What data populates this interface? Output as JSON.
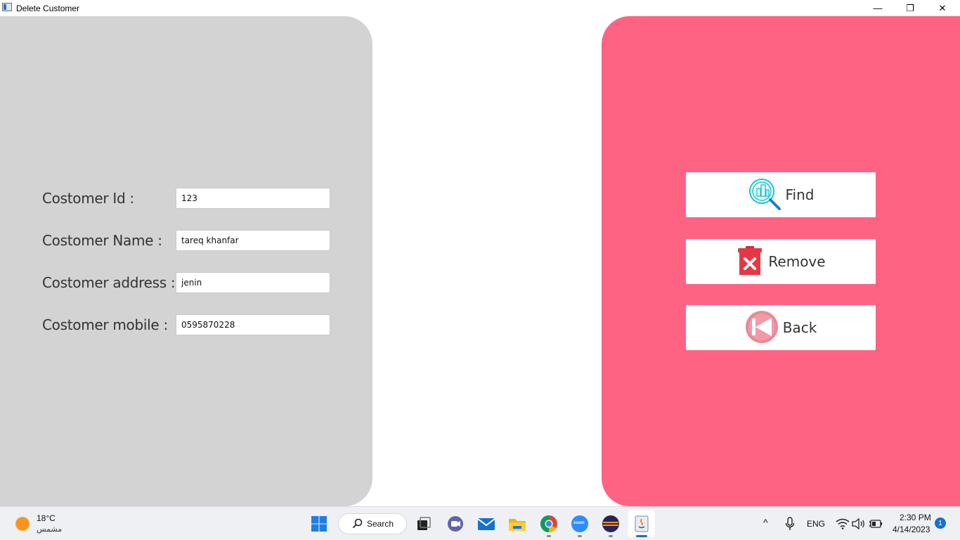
{
  "window": {
    "title": "Delete Customer",
    "minimize_glyph": "—",
    "maximize_glyph": "❐",
    "close_glyph": "✕"
  },
  "form": {
    "id_label": "Costomer Id :",
    "id_value": "123",
    "name_label": "Costomer Name :",
    "name_value": "tareq khanfar",
    "address_label": "Costomer address :",
    "address_value": "jenin",
    "mobile_label": "Costomer mobile :",
    "mobile_value": "0595870228"
  },
  "actions": {
    "find_label": "Find",
    "remove_label": "Remove",
    "back_label": "Back"
  },
  "colors": {
    "left_panel": "#d3d3d3",
    "right_panel": "#ff6384",
    "button_bg": "#ffffff"
  },
  "taskbar": {
    "weather_temp": "18°C",
    "weather_condition": "مشمس",
    "search_label": "Search",
    "language": "ENG",
    "time": "2:30 PM",
    "date": "4/14/2023",
    "notification_count": "1",
    "zoom_label": "zoom"
  }
}
